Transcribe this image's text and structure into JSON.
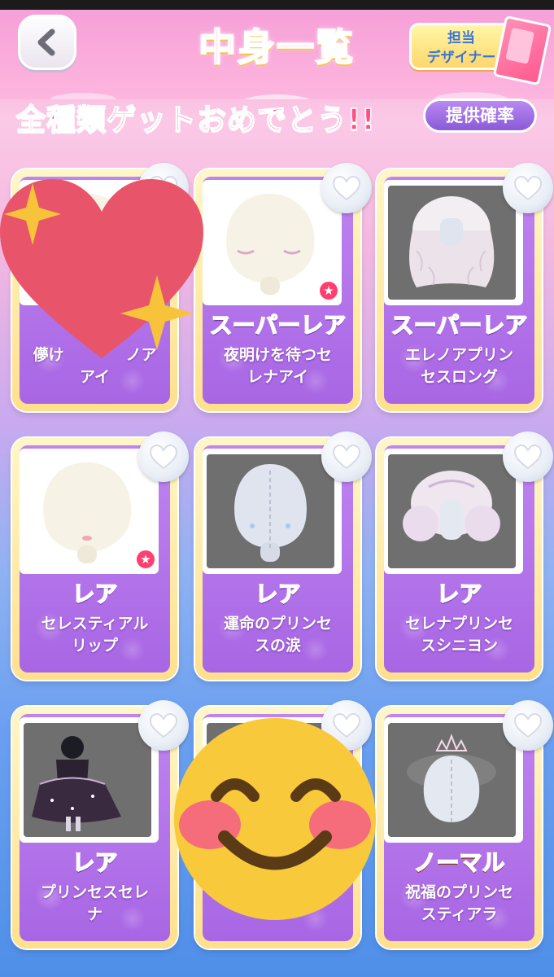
{
  "header": {
    "title": "中身一覧",
    "designer_label_line1": "担当",
    "designer_label_line2": "デザイナー"
  },
  "banner": {
    "text": "全種類ゲットおめでとう!!",
    "odds_button": "提供確率"
  },
  "cards": [
    {
      "rarity": "",
      "name_line1": "儚け　　　　ノア",
      "name_line2": "アイ",
      "thumb": "white",
      "item": "eye-face"
    },
    {
      "rarity": "スーパーレア",
      "name_line1": "夜明けを待つセ",
      "name_line2": "レナアイ",
      "thumb": "white",
      "item": "eye-face"
    },
    {
      "rarity": "スーパーレア",
      "name_line1": "エレノアプリン",
      "name_line2": "セスロング",
      "thumb": "gray",
      "item": "long-hair"
    },
    {
      "rarity": "レア",
      "name_line1": "セレスティアル",
      "name_line2": "リップ",
      "thumb": "white",
      "item": "lip-face"
    },
    {
      "rarity": "レア",
      "name_line1": "運命のプリンセ",
      "name_line2": "スの涙",
      "thumb": "gray",
      "item": "tear-face"
    },
    {
      "rarity": "レア",
      "name_line1": "セレナプリンセ",
      "name_line2": "スシニヨン",
      "thumb": "gray",
      "item": "bun-hair"
    },
    {
      "rarity": "レア",
      "name_line1": "プリンセスセレ",
      "name_line2": "ナ",
      "thumb": "gray",
      "item": "dress"
    },
    {
      "rarity": "",
      "name_line1": "",
      "name_line2": "",
      "thumb": "gray",
      "item": "none"
    },
    {
      "rarity": "ノーマル",
      "name_line1": "祝福のプリンセ",
      "name_line2": "スティアラ",
      "thumb": "gray",
      "item": "tiara"
    }
  ],
  "icons": {
    "back": "chevron-left-icon",
    "favorite": "heart-icon",
    "new_badge": "star-icon"
  },
  "colors": {
    "accent": "#ff4f86",
    "card_bg": "#b274ea",
    "odds_button": "#9b6ae0"
  }
}
